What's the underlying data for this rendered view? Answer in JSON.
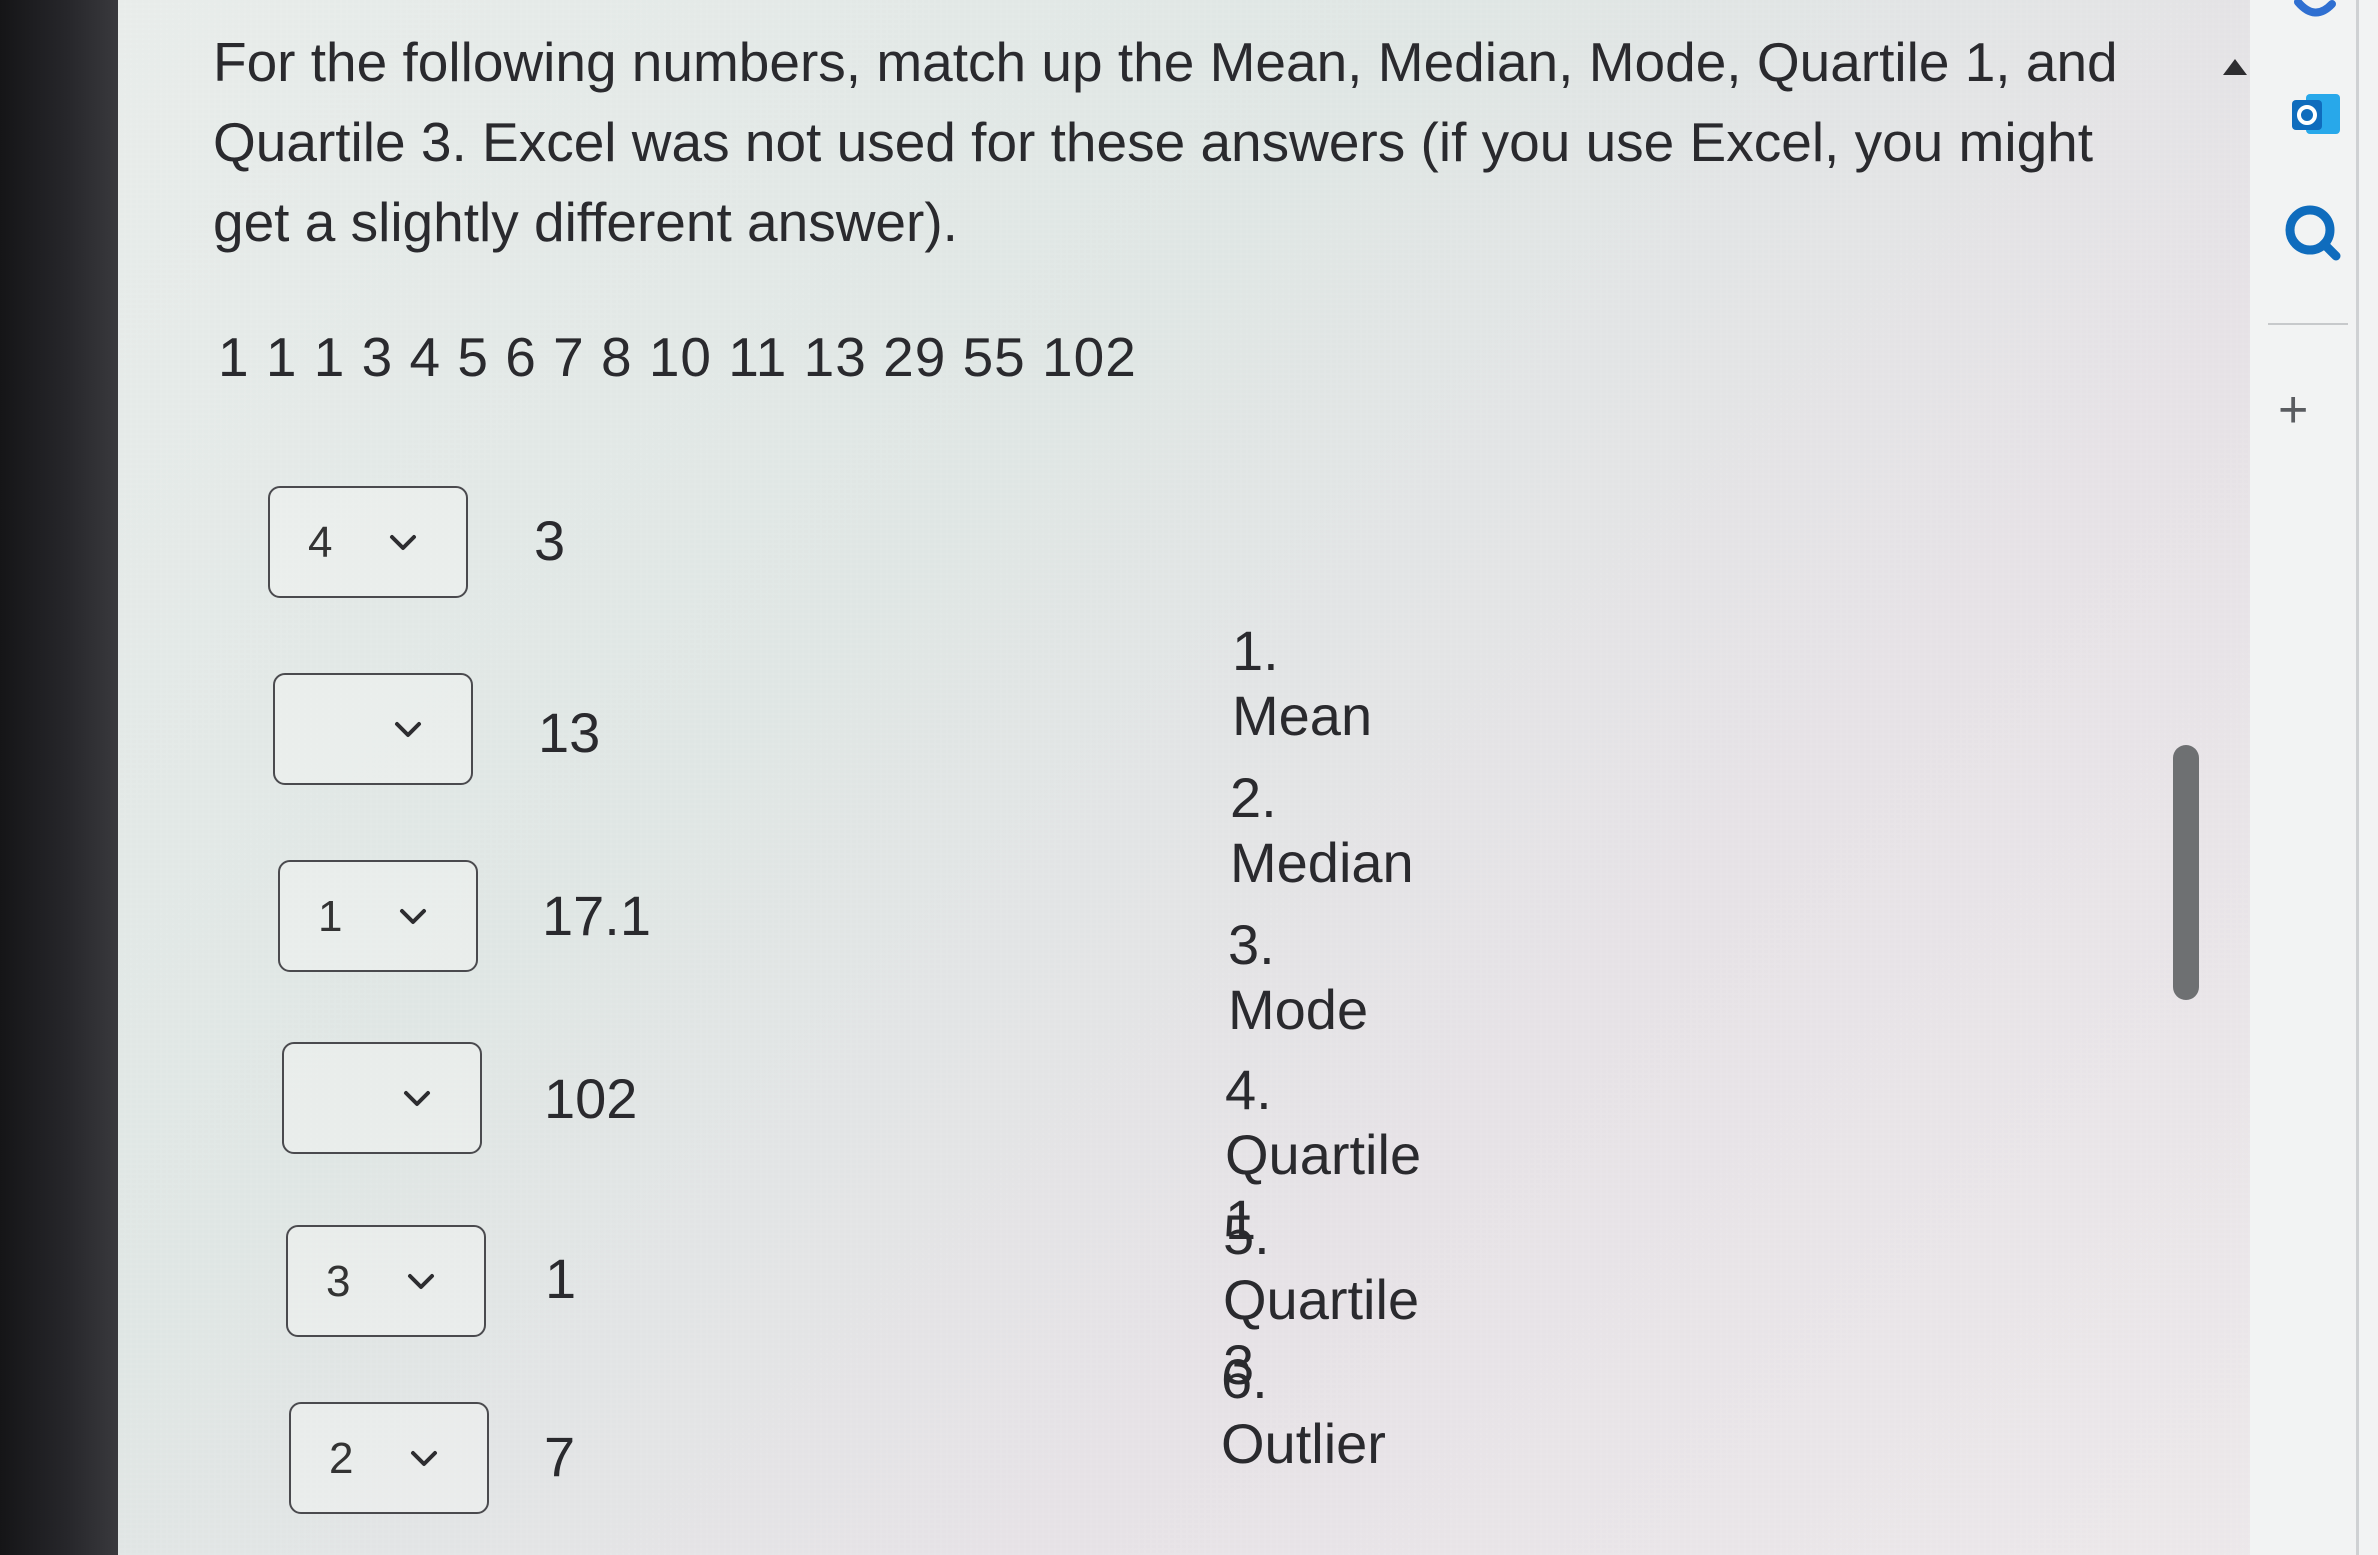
{
  "question": {
    "text": "For the following numbers, match up the Mean, Median, Mode, Quartile 1, and Quartile 3. Excel was not used for these answers (if you use Excel, you might get a slightly different answer).",
    "numbers": "1  1  1  3  4  5  6  7  8  10  11  13  29  55  102"
  },
  "rows": [
    {
      "selected": "4",
      "value": "3"
    },
    {
      "selected": "",
      "value": "13"
    },
    {
      "selected": "1",
      "value": "17.1"
    },
    {
      "selected": "",
      "value": "102"
    },
    {
      "selected": "3",
      "value": "1"
    },
    {
      "selected": "2",
      "value": "7"
    }
  ],
  "options": [
    {
      "num": "1.",
      "label": "Mean"
    },
    {
      "num": "2.",
      "label": "Median"
    },
    {
      "num": "3.",
      "label": "Mode"
    },
    {
      "num": "4.",
      "label": "Quartile 1"
    },
    {
      "num": "5.",
      "label": "Quartile 3"
    },
    {
      "num": "6.",
      "label": "Outlier"
    }
  ],
  "right_rail": {
    "icons": [
      "outlook-icon",
      "search-icon"
    ],
    "plus_label": "+"
  },
  "colors": {
    "text": "#2a2a2e",
    "accent_blue": "#0f6cbd",
    "scroll_thumb": "#6e7072"
  }
}
